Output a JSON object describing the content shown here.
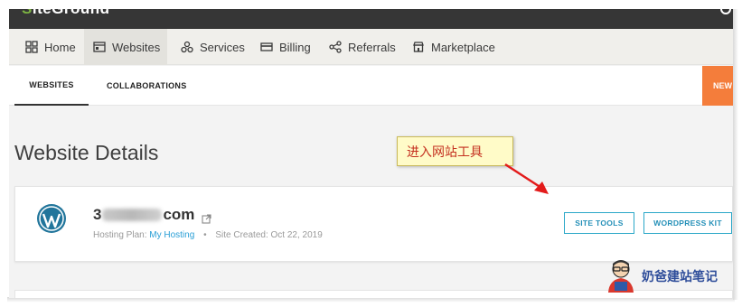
{
  "topbar": {
    "logo_text_fragment": "SiteGround"
  },
  "nav": {
    "items": [
      {
        "label": "Home",
        "icon": "grid-icon"
      },
      {
        "label": "Websites",
        "icon": "browser-icon"
      },
      {
        "label": "Services",
        "icon": "services-icon"
      },
      {
        "label": "Billing",
        "icon": "card-icon"
      },
      {
        "label": "Referrals",
        "icon": "share-icon"
      },
      {
        "label": "Marketplace",
        "icon": "store-icon"
      }
    ],
    "active": "Websites"
  },
  "subnav": {
    "tabs": [
      "WEBSITES",
      "COLLABORATIONS"
    ],
    "active": "WEBSITES",
    "new_button": "NEW"
  },
  "page": {
    "title": "Website Details"
  },
  "site": {
    "domain_prefix": "3",
    "domain_suffix": "com",
    "hosting_plan_label": "Hosting Plan:",
    "hosting_plan_value": "My Hosting",
    "created_label": "Site Created: Oct 22, 2019",
    "buttons": {
      "site_tools": "SITE TOOLS",
      "wordpress_kit": "WORDPRESS KIT"
    }
  },
  "annotation": {
    "callout_text": "进入网站工具"
  },
  "watermark": {
    "text": "奶爸建站笔记"
  },
  "colors": {
    "accent": "#2aa7c8",
    "new_button": "#f47d3b",
    "callout_text": "#c42f1f",
    "arrow": "#e31b1b"
  }
}
